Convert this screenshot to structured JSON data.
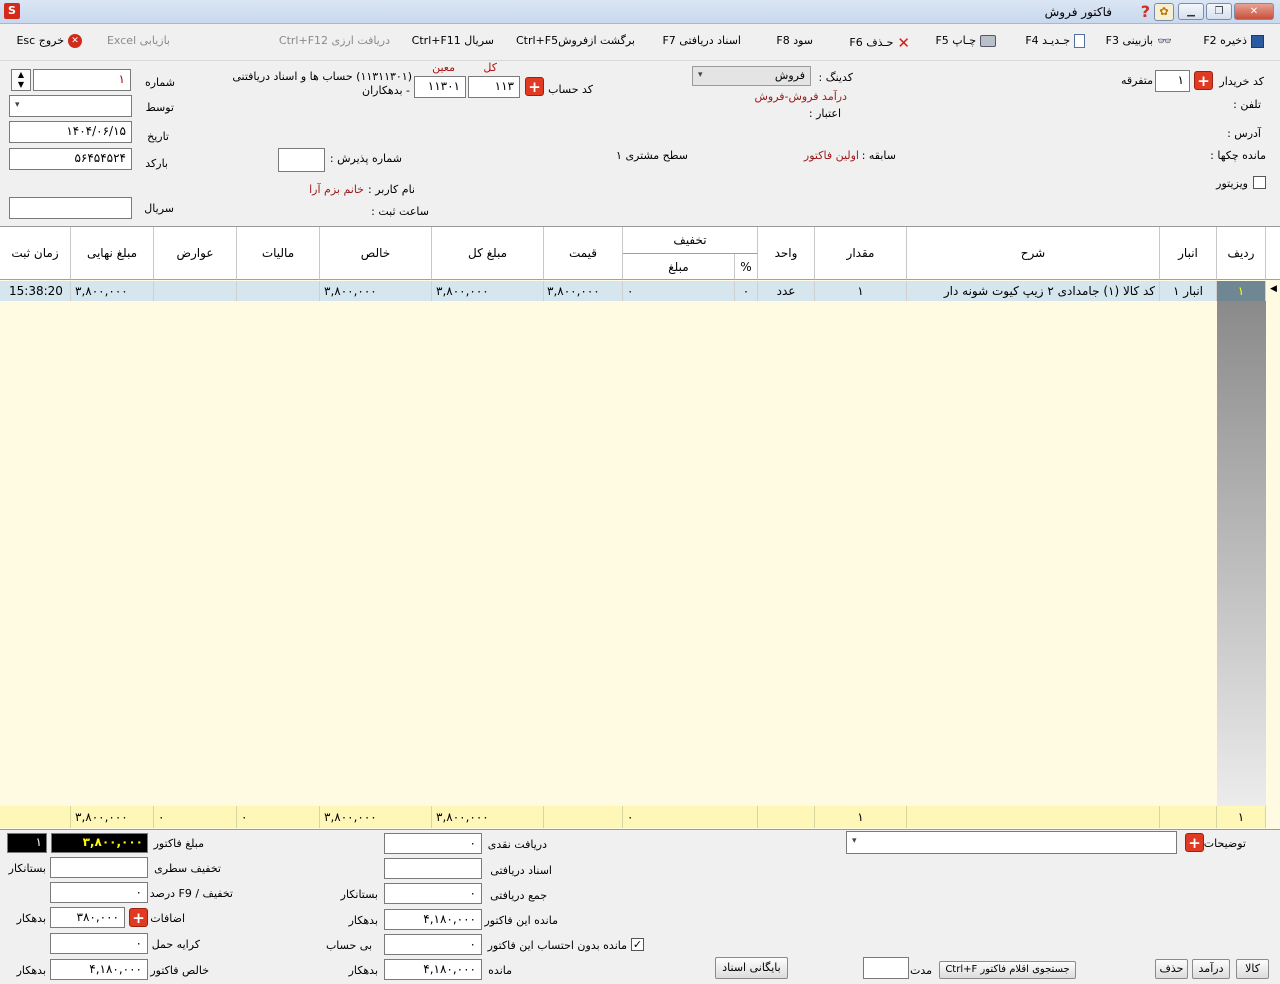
{
  "window": {
    "title": "فاکتور فروش"
  },
  "toolbar": {
    "save": "ذخیره F2",
    "view": "بازبینی F3",
    "new": "جـدیـد F4",
    "print": "چـاپ F5",
    "delete": "حـذف F6",
    "profit": "سود F8",
    "received_docs": "اسناد دریافتی F7",
    "return_sale": "برگشت ازفروشCtrl+F5",
    "serial": "سریال  Ctrl+F11",
    "currency": "دریافت ارزی Ctrl+F12",
    "excel": "بازیابی Excel",
    "exit": "خروج Esc"
  },
  "header": {
    "buyer_code_label": "کد خریدار",
    "buyer_code": "۱",
    "misc_label": "متفرقه",
    "phone_label": "تلفن :",
    "address_label": "آدرس :",
    "checks_label": "مانده چکها :",
    "visitor_label": "ویزیتور",
    "coding_label": "کدینگ :",
    "coding_value": "فروش",
    "coding_desc": "درآمد فروش-فروش",
    "credit_label": "اعتبار :",
    "history_label": "سابقه :",
    "history_value": "اولین فاکتور",
    "level_label": "سطح مشتری ۱",
    "account_label": "کد حساب",
    "kol_label": "کل",
    "moin_label": "معین",
    "kol_value": "۱۱۳",
    "moin_value": "۱۱۳۰۱",
    "account_desc1": "(۱۱۳۱۱۳۰۱) حساب ها و اسناد دریافتنی",
    "account_desc2": "- بدهکاران",
    "reception_label": "شماره پذیرش :",
    "username_label": "نام کاربر :",
    "username_value": "خانم بزم آرا",
    "regtime_label": "ساعت ثبت :",
    "number_label": "شماره",
    "number_value": "۱",
    "by_label": "توسط",
    "date_label": "تاریخ",
    "date_value": "۱۴۰۴/۰۶/۱۵",
    "barcode_label": "بارکد",
    "barcode_value": "۵۶۴۵۴۵۲۴",
    "serial_label": "سریال"
  },
  "grid": {
    "columns": {
      "row": "ردیف",
      "warehouse": "انبار",
      "desc": "شرح",
      "qty": "مقدار",
      "unit": "واحد",
      "discount": "تخفیف",
      "percent": "%",
      "amount": "مبلغ",
      "price": "قیمت",
      "total": "مبلغ کل",
      "net": "خالص",
      "tax": "مالیات",
      "duties": "عوارض",
      "final": "مبلغ نهایی",
      "time": "زمان ثبت"
    },
    "rows": [
      {
        "row": "۱",
        "warehouse": "انبار ۱",
        "desc": "کد کالا (۱) جامدادی ۲ زیپ کیوت شونه دار",
        "qty": "۱",
        "unit": "عدد",
        "percent": "۰",
        "amount": "۰",
        "price": "۳,۸۰۰,۰۰۰",
        "total": "۳,۸۰۰,۰۰۰",
        "net": "۳,۸۰۰,۰۰۰",
        "tax": "",
        "duties": "",
        "final": "۳,۸۰۰,۰۰۰",
        "time": "15:38:20"
      }
    ],
    "footer": {
      "row": "۱",
      "qty": "۱",
      "amount": "۰",
      "total": "۳,۸۰۰,۰۰۰",
      "net": "۳,۸۰۰,۰۰۰",
      "tax": "۰",
      "duties": "۰",
      "final": "۳,۸۰۰,۰۰۰"
    }
  },
  "summary": {
    "invoice_amount_label": "مبلغ فاکتور",
    "invoice_amount": "۳,۸۰۰,۰۰۰",
    "count": "۱",
    "line_discount_label": "تخفیف سطری",
    "line_discount_side": "بستانکار",
    "pct_discount_label": "تخفیف / F9 درصد",
    "pct_discount": "۰",
    "additions_label": "اضافات",
    "additions": "۳۸۰,۰۰۰",
    "additions_side": "بدهکار",
    "freight_label": "کرایه حمل",
    "freight": "۰",
    "net_invoice_label": "خالص فاکتور",
    "net_invoice": "۴,۱۸۰,۰۰۰",
    "net_invoice_side": "بدهکار",
    "cash_label": "دریافت نقدی",
    "cash": "۰",
    "docs_label": "اسناد دریافتی",
    "total_received_label": "جمع دریافتی",
    "total_received": "۰",
    "total_received_side": "بستانکار",
    "balance_this_label": "مانده این فاکتور",
    "balance_this": "۴,۱۸۰,۰۰۰",
    "balance_this_side": "بدهکار",
    "balance_excl_label": "مانده بدون احتساب این فاکتور",
    "balance_excl": "۰",
    "balance_excl_side": "بی حساب",
    "balance_label": "مانده",
    "balance": "۴,۱۸۰,۰۰۰",
    "balance_side": "بدهکار",
    "notes_label": "توضیحات",
    "archive_btn": "بایگانی اسناد",
    "duration_label": "مدت",
    "search_btn": "جستجوی اقلام فاکتور Ctrl+F",
    "goods_btn": "کالا",
    "income_btn": "درآمد",
    "delete_btn": "حذف"
  }
}
